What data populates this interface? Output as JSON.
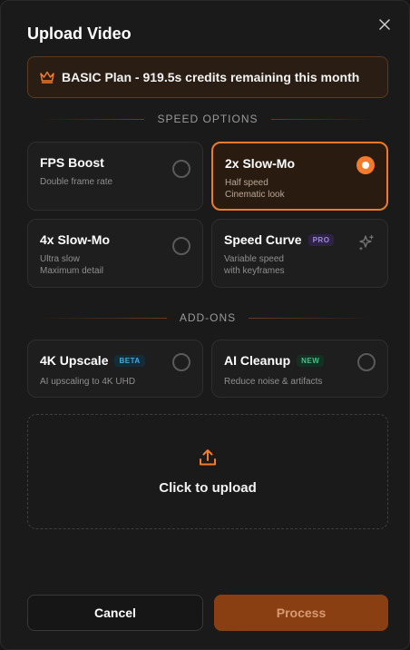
{
  "dialog": {
    "title": "Upload Video",
    "close_icon": "close-icon"
  },
  "plan": {
    "icon": "crown-icon",
    "text": "BASIC Plan - 919.5s credits remaining this month"
  },
  "speed_options": {
    "heading": "SPEED OPTIONS",
    "items": [
      {
        "name": "FPS Boost",
        "desc1": "Double frame rate",
        "desc2": "",
        "selected": false
      },
      {
        "name": "2x Slow-Mo",
        "desc1": "Half speed",
        "desc2": "Cinematic look",
        "selected": true
      },
      {
        "name": "4x Slow-Mo",
        "desc1": "Ultra slow",
        "desc2": "Maximum detail",
        "selected": false
      },
      {
        "name": "Speed Curve",
        "badge": "PRO",
        "desc1": "Variable speed",
        "desc2": "with keyframes",
        "icon": "sparkle-icon",
        "selected": false
      }
    ]
  },
  "addons": {
    "heading": "ADD-ONS",
    "items": [
      {
        "name": "4K Upscale",
        "badge": "BETA",
        "desc1": "AI upscaling to 4K UHD",
        "selected": false
      },
      {
        "name": "AI Cleanup",
        "badge": "NEW",
        "desc1": "Reduce noise & artifacts",
        "selected": false
      }
    ]
  },
  "upload": {
    "icon": "upload-icon",
    "label": "Click to upload"
  },
  "footer": {
    "cancel_label": "Cancel",
    "process_label": "Process"
  },
  "colors": {
    "accent": "#f47a2c",
    "background": "#1a1a1a",
    "card": "#1e1e1e"
  }
}
